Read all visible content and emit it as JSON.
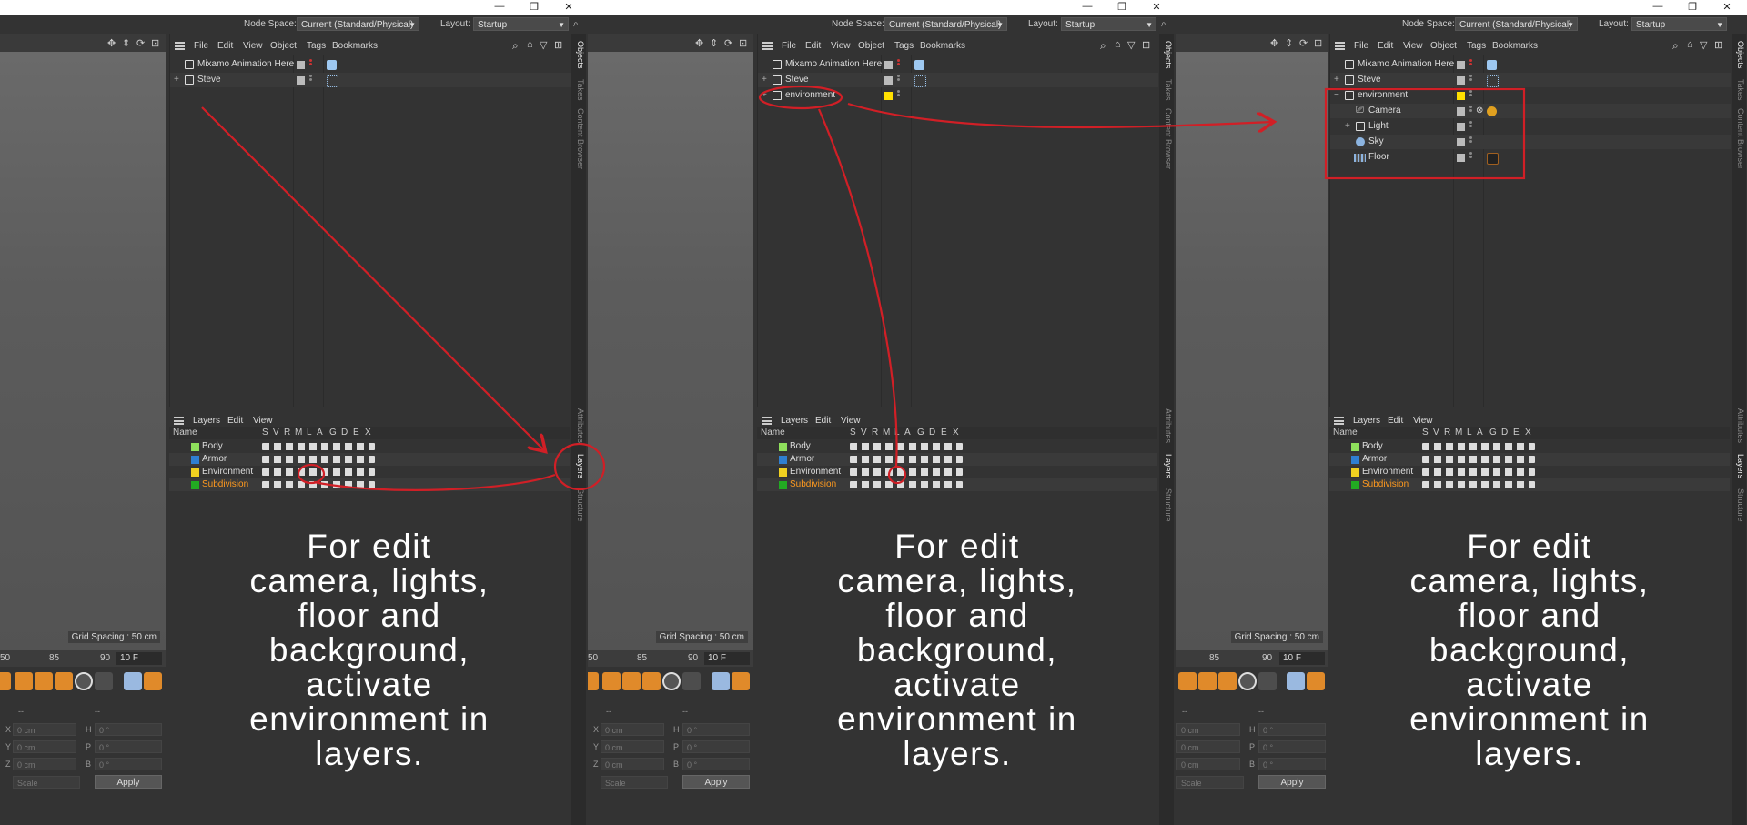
{
  "topbar": {
    "node_space_label": "Node Space:",
    "node_space_value": "Current (Standard/Physical)",
    "layout_label": "Layout:",
    "layout_value": "Startup",
    "minimize": "—",
    "restore": "❐",
    "close": "✕"
  },
  "om_menu": {
    "file": "File",
    "edit": "Edit",
    "view": "View",
    "object": "Object",
    "tags": "Tags",
    "bookmarks": "Bookmarks"
  },
  "objects_p1": [
    "Mixamo Animation Here",
    "Steve"
  ],
  "objects_p2": [
    "Mixamo Animation Here",
    "Steve",
    "environment"
  ],
  "objects_p3": [
    "Mixamo Animation Here",
    "Steve",
    "environment",
    "Camera",
    "Light",
    "Sky",
    "Floor"
  ],
  "layers_menu": {
    "layers": "Layers",
    "edit": "Edit",
    "view": "View"
  },
  "layer_cols": {
    "name": "Name",
    "s": "S",
    "v": "V",
    "r": "R",
    "m": "M",
    "l": "L",
    "a": "A",
    "g": "G",
    "d": "D",
    "e": "E",
    "x": "X"
  },
  "layers": [
    {
      "name": "Body",
      "color": "#8fe05c"
    },
    {
      "name": "Armor",
      "color": "#2f7fd0"
    },
    {
      "name": "Environment",
      "color": "#f0d020"
    },
    {
      "name": "Subdivision",
      "color": "#22aa22",
      "text_color": "#ff9a1f"
    }
  ],
  "viewport": {
    "grid_spacing": "Grid Spacing : 50 cm"
  },
  "timeline": {
    "p1_ticks": [
      "50",
      "85",
      "90"
    ],
    "p2_ticks": [
      "50",
      "85",
      "90"
    ],
    "p3_ticks": [
      "85",
      "90"
    ],
    "frames": "10 F"
  },
  "coords": {
    "x": "X",
    "y": "Y",
    "z": "Z",
    "h": "H",
    "p": "P",
    "b": "B",
    "val_cm": "0 cm",
    "val_deg": "0 °",
    "dash": "--",
    "scale": "Scale",
    "apply": "Apply"
  },
  "side_tabs": [
    "Objects",
    "Takes",
    "Content Browser",
    "Attributes",
    "Layers",
    "Structure"
  ],
  "caption": "For edit\ncamera, lights,\nfloor and\nbackground,\nactivate\nenvironment in\nlayers.",
  "colors": {
    "annotation_red": "#d11f26",
    "accent_orange": "#e08a2a",
    "env_yellow": "#ffe000"
  }
}
